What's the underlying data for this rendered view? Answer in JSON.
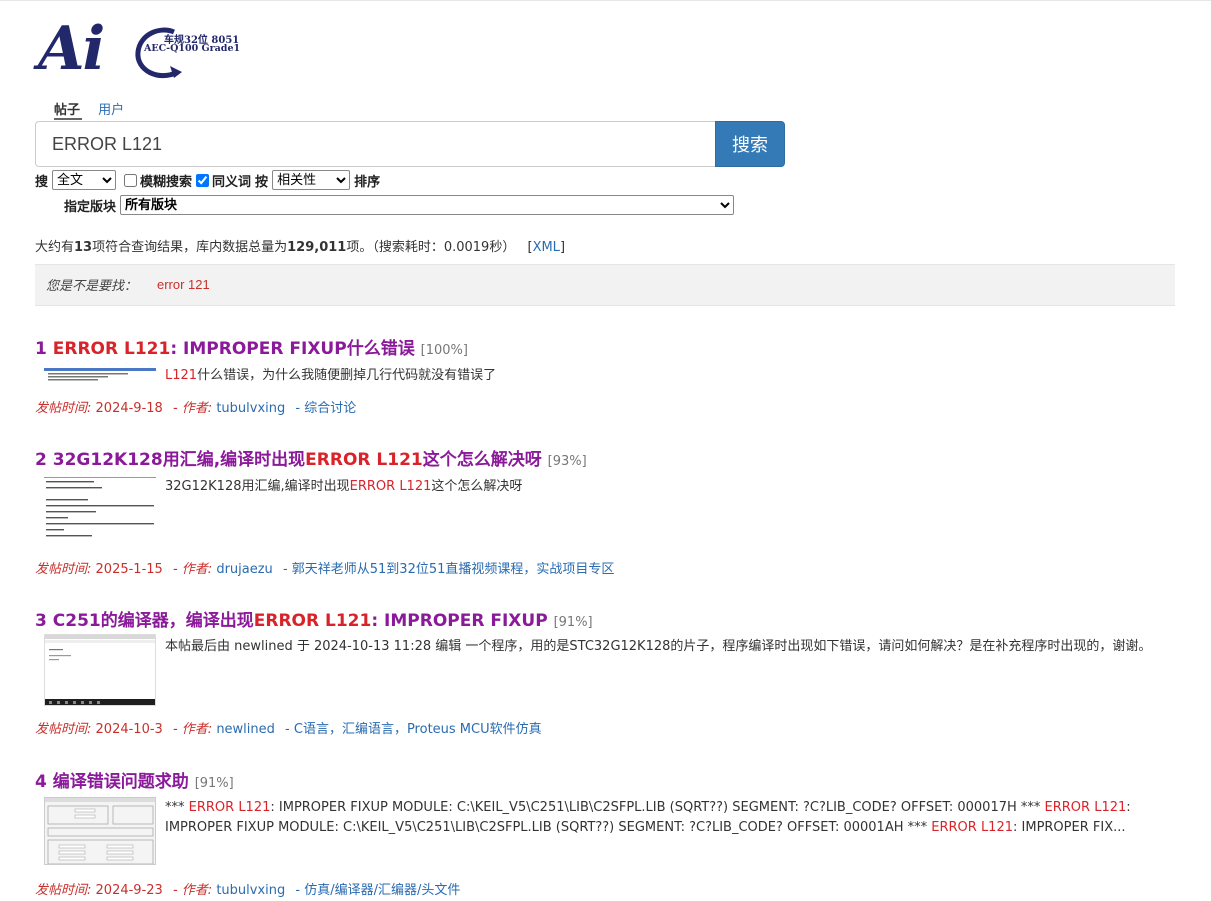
{
  "logo": {
    "text": "Ai",
    "line1": "车规32位 8051",
    "line2": "AEC-Q100 Grade1"
  },
  "tabs": [
    {
      "label": "帖子",
      "active": true
    },
    {
      "label": "用户",
      "active": false
    }
  ],
  "search": {
    "value": "ERROR L121",
    "button": "搜索"
  },
  "options": {
    "search_prefix": "搜",
    "scope": "全文",
    "fuzzy_label": "模糊搜索",
    "fuzzy_checked": false,
    "synonym_label": "同义词",
    "synonym_checked": true,
    "by": "按",
    "sort": "相关性",
    "sort_suffix": "排序",
    "section_label": "指定版块",
    "section": "所有版块"
  },
  "stats": {
    "prefix": "大约有",
    "count": "13",
    "mid": "项符合查询结果，库内数据总量为",
    "total": "129,011",
    "suffix": "项。（搜索耗时：0.0019秒）",
    "xml_open": "[",
    "xml": "XML",
    "xml_close": "]"
  },
  "did_you_mean": {
    "label": "您是不是要找：",
    "suggestion": "error 121"
  },
  "results": [
    {
      "num": "1",
      "title_parts": [
        {
          "text": "ERROR L121",
          "hl": true
        },
        {
          "text": ": IMPROPER FIXUP什么错误",
          "hl": false
        }
      ],
      "pct": "[100%]",
      "snippet_parts": [
        {
          "text": "L121",
          "hl": true
        },
        {
          "text": "什么错误，为什么我随便删掉几行代码就没有错误了",
          "hl": false
        }
      ],
      "date_label": "发帖时间:",
      "date": "2024-9-18",
      "author_label": "- 作者:",
      "author": "tubulvxing",
      "forum": "- 综合讨论"
    },
    {
      "num": "2",
      "title_parts": [
        {
          "text": "32G12K128用汇编,编译时出现",
          "hl": false
        },
        {
          "text": "ERROR L121",
          "hl": true
        },
        {
          "text": "这个怎么解决呀",
          "hl": false
        }
      ],
      "pct": "[93%]",
      "snippet_parts": [
        {
          "text": "32G12K128用汇编,编译时出现",
          "hl": false
        },
        {
          "text": "ERROR L121",
          "hl": true
        },
        {
          "text": "这个怎么解决呀",
          "hl": false
        }
      ],
      "date_label": "发帖时间:",
      "date": "2025-1-15",
      "author_label": "- 作者:",
      "author": "drujaezu",
      "forum": "- 郭天祥老师从51到32位51直播视频课程，实战项目专区"
    },
    {
      "num": "3",
      "title_parts": [
        {
          "text": "C251的编译器，编译出现",
          "hl": false
        },
        {
          "text": "ERROR L121",
          "hl": true
        },
        {
          "text": ": IMPROPER FIXUP",
          "hl": false
        }
      ],
      "pct": "[91%]",
      "snippet_parts": [
        {
          "text": "本帖最后由 newlined 于 2024-10-13 11:28 编辑 一个程序，用的是STC32G12K128的片子，程序编译时出现如下错误，请问如何解决？是在补充程序时出现的，谢谢。",
          "hl": false
        }
      ],
      "date_label": "发帖时间:",
      "date": "2024-10-3",
      "author_label": "- 作者:",
      "author": "newlined",
      "forum": "- C语言，汇编语言，Proteus MCU软件仿真"
    },
    {
      "num": "4",
      "title_parts": [
        {
          "text": "编译错误问题求助",
          "hl": false
        }
      ],
      "pct": "[91%]",
      "snippet_parts": [
        {
          "text": "*** ",
          "hl": false
        },
        {
          "text": "ERROR L121",
          "hl": true
        },
        {
          "text": ": IMPROPER FIXUP MODULE: C:\\KEIL_V5\\C251\\LIB\\C2SFPL.LIB (SQRT??) SEGMENT: ?C?LIB_CODE? OFFSET: 000017H *** ",
          "hl": false
        },
        {
          "text": "ERROR L121",
          "hl": true
        },
        {
          "text": ": IMPROPER FIXUP MODULE: C:\\KEIL_V5\\C251\\LIB\\C2SFPL.LIB (SQRT??) SEGMENT: ?C?LIB_CODE? OFFSET: 00001AH *** ",
          "hl": false
        },
        {
          "text": "ERROR L121",
          "hl": true
        },
        {
          "text": ": IMPROPER FIX...",
          "hl": false
        }
      ],
      "date_label": "发帖时间:",
      "date": "2024-9-23",
      "author_label": "- 作者:",
      "author": "tubulvxing",
      "forum": "- 仿真/编译器/汇编器/头文件"
    }
  ],
  "colors": {
    "title": "#8b1a9a",
    "highlight": "#d9232a",
    "link": "#2a6bb0",
    "meta": "#c9302c",
    "button": "#337ab7"
  }
}
